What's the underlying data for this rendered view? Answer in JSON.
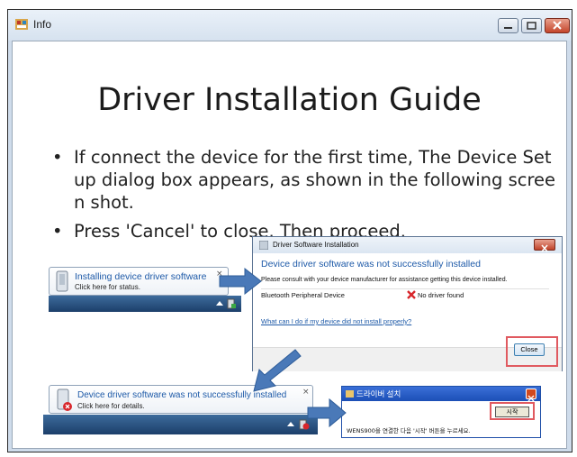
{
  "window": {
    "title": "Info"
  },
  "slide": {
    "title": "Driver Installation Guide",
    "bullets": [
      {
        "marker": "•",
        "lines": [
          "If connect the device for the first time, The Device Set",
          "up dialog box appears, as shown in the following scree",
          "n shot."
        ]
      },
      {
        "marker": "•",
        "lines": [
          "Press 'Cancel' to close. Then proceed."
        ]
      }
    ]
  },
  "toast_installing": {
    "title": "Installing device driver software",
    "subtitle": "Click here for status."
  },
  "toast_failed": {
    "title": "Device driver software was not successfully installed",
    "subtitle": "Click here for details."
  },
  "driver_dialog": {
    "title": "Driver Software Installation",
    "heading": "Device driver software was not successfully installed",
    "body": "Please consult with your device manufacturer for assistance getting this device installed.",
    "device": "Bluetooth Peripheral Device",
    "status": "No driver found",
    "link": "What can I do if my device did not install properly?",
    "close_button": "Close"
  },
  "korean_dialog": {
    "title": "드라이버 설치",
    "start_button": "시작",
    "message": "WENS900을 연결한 다음 '시작' 버튼을 누르세요."
  },
  "colors": {
    "accent": "#1e5aa8",
    "highlight": "#e05a60",
    "arrow": "#4a79b8"
  }
}
